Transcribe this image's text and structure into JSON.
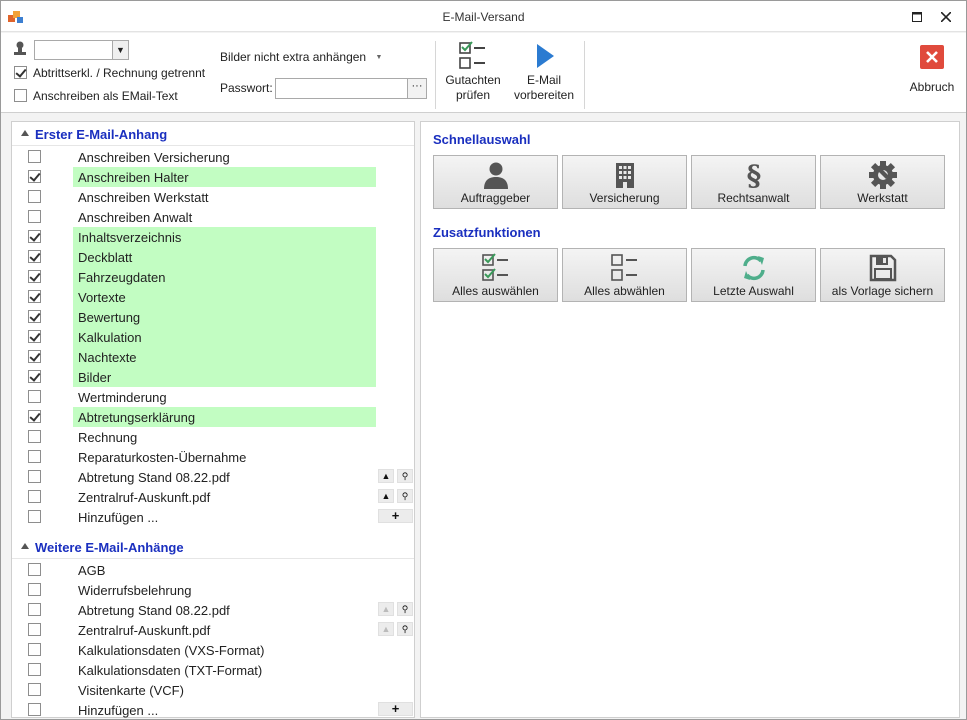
{
  "window": {
    "title": "E-Mail-Versand"
  },
  "toolbar": {
    "combo_value": "",
    "chk_abtritt": {
      "label": "Abtrittserkl. / Rechnung getrennt",
      "checked": true
    },
    "chk_email_text": {
      "label": "Anschreiben als EMail-Text",
      "checked": false
    },
    "images_mode": "Bilder nicht extra anhängen",
    "password_label": "Passwort:",
    "password_value": "",
    "check_report_btn": [
      "Gutachten",
      "prüfen"
    ],
    "prepare_email_btn": [
      "E-Mail",
      "vorbereiten"
    ],
    "cancel_btn": "Abbruch"
  },
  "first_attachment": {
    "title": "Erster E-Mail-Anhang",
    "items": [
      {
        "label": "Anschreiben Versicherung",
        "checked": false,
        "highlight": false
      },
      {
        "label": "Anschreiben Halter",
        "checked": true,
        "highlight": true
      },
      {
        "label": "Anschreiben Werkstatt",
        "checked": false,
        "highlight": false
      },
      {
        "label": "Anschreiben Anwalt",
        "checked": false,
        "highlight": false
      },
      {
        "label": "Inhaltsverzeichnis",
        "checked": true,
        "highlight": true
      },
      {
        "label": "Deckblatt",
        "checked": true,
        "highlight": true
      },
      {
        "label": "Fahrzeugdaten",
        "checked": true,
        "highlight": true
      },
      {
        "label": "Vortexte",
        "checked": true,
        "highlight": true
      },
      {
        "label": "Bewertung",
        "checked": true,
        "highlight": true
      },
      {
        "label": "Kalkulation",
        "checked": true,
        "highlight": true
      },
      {
        "label": "Nachtexte",
        "checked": true,
        "highlight": true
      },
      {
        "label": "Bilder",
        "checked": true,
        "highlight": true
      },
      {
        "label": "Wertminderung",
        "checked": false,
        "highlight": false
      },
      {
        "label": "Abtretungserklärung",
        "checked": true,
        "highlight": true
      },
      {
        "label": "Rechnung",
        "checked": false,
        "highlight": false
      },
      {
        "label": "Reparaturkosten-Übernahme",
        "checked": false,
        "highlight": false
      },
      {
        "label": "Abtretung Stand 08.22.pdf",
        "checked": false,
        "highlight": false,
        "tools": "updown"
      },
      {
        "label": "Zentralruf-Auskunft.pdf",
        "checked": false,
        "highlight": false,
        "tools": "updown"
      },
      {
        "label": "Hinzufügen ...",
        "checked": false,
        "highlight": false,
        "tools": "add"
      }
    ]
  },
  "more_attachments": {
    "title": "Weitere E-Mail-Anhänge",
    "items": [
      {
        "label": "AGB",
        "checked": false,
        "highlight": false
      },
      {
        "label": "Widerrufsbelehrung",
        "checked": false,
        "highlight": false
      },
      {
        "label": "Abtretung Stand 08.22.pdf",
        "checked": false,
        "highlight": false,
        "tools": "updown-dim"
      },
      {
        "label": "Zentralruf-Auskunft.pdf",
        "checked": false,
        "highlight": false,
        "tools": "updown-dim"
      },
      {
        "label": "Kalkulationsdaten (VXS-Format)",
        "checked": false,
        "highlight": false
      },
      {
        "label": "Kalkulationsdaten (TXT-Format)",
        "checked": false,
        "highlight": false
      },
      {
        "label": "Visitenkarte (VCF)",
        "checked": false,
        "highlight": false
      },
      {
        "label": "Hinzufügen ...",
        "checked": false,
        "highlight": false,
        "tools": "add"
      }
    ]
  },
  "quick_select": {
    "title": "Schnellauswahl",
    "buttons": [
      {
        "label": "Auftraggeber",
        "icon": "person-icon"
      },
      {
        "label": "Versicherung",
        "icon": "building-icon"
      },
      {
        "label": "Rechtsanwalt",
        "icon": "paragraph-icon"
      },
      {
        "label": "Werkstatt",
        "icon": "gear-icon"
      }
    ]
  },
  "extra_functions": {
    "title": "Zusatzfunktionen",
    "buttons": [
      {
        "label": "Alles auswählen",
        "icon": "checklist-checked-icon"
      },
      {
        "label": "Alles abwählen",
        "icon": "checklist-empty-icon"
      },
      {
        "label": "Letzte Auswahl",
        "icon": "refresh-icon"
      },
      {
        "label": "als Vorlage sichern",
        "icon": "save-icon"
      }
    ]
  },
  "colors": {
    "accent_blue": "#1a2fbf",
    "highlight_green": "#c2fdc2",
    "cancel_red": "#e04a3c",
    "play_blue": "#2b7bd1",
    "refresh_green": "#4fae8b"
  }
}
